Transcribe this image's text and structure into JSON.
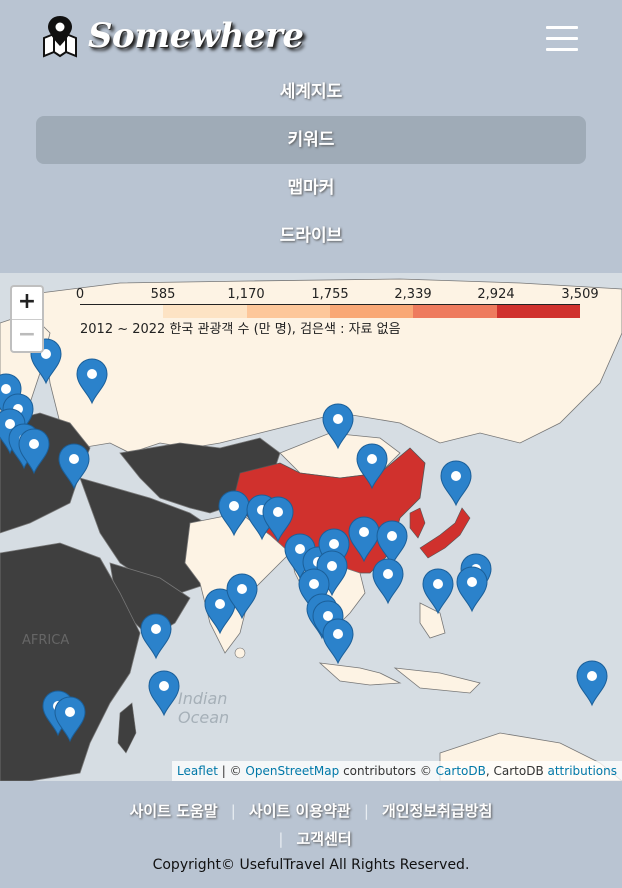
{
  "header": {
    "logo_text": "Somewhere",
    "nav": [
      {
        "label": "세계지도",
        "active": false
      },
      {
        "label": "키워드",
        "active": true
      },
      {
        "label": "맵마커",
        "active": false
      },
      {
        "label": "드라이브",
        "active": false
      }
    ]
  },
  "map": {
    "zoom_in": "+",
    "zoom_out": "−",
    "legend": {
      "ticks": [
        "0",
        "585",
        "1,170",
        "1,755",
        "2,339",
        "2,924",
        "3,509"
      ],
      "colors": [
        "#fdf3e4",
        "#fde3c4",
        "#fdc79a",
        "#f9a876",
        "#ee7b5e",
        "#d0312d"
      ],
      "caption": "2012 ~ 2022 한국 관광객 수 (만 명), 검은색 : 자료 없음"
    },
    "labels": {
      "africa": "AFRICA",
      "indian_ocean_1": "Indian",
      "indian_ocean_2": "Ocean"
    },
    "attribution": {
      "leaflet": "Leaflet",
      "sep1": " | © ",
      "osm": "OpenStreetMap",
      "contributors": " contributors © ",
      "cartodb": "CartoDB",
      "cartodb2": ", CartoDB ",
      "attributions": "attributions"
    }
  },
  "footer": {
    "links": [
      "사이트 도움말",
      "사이트 이용약관",
      "개인정보취급방침",
      "고객센터"
    ],
    "separator": "|",
    "copyright": "Copyright© UsefulTravel All Rights Reserved."
  }
}
